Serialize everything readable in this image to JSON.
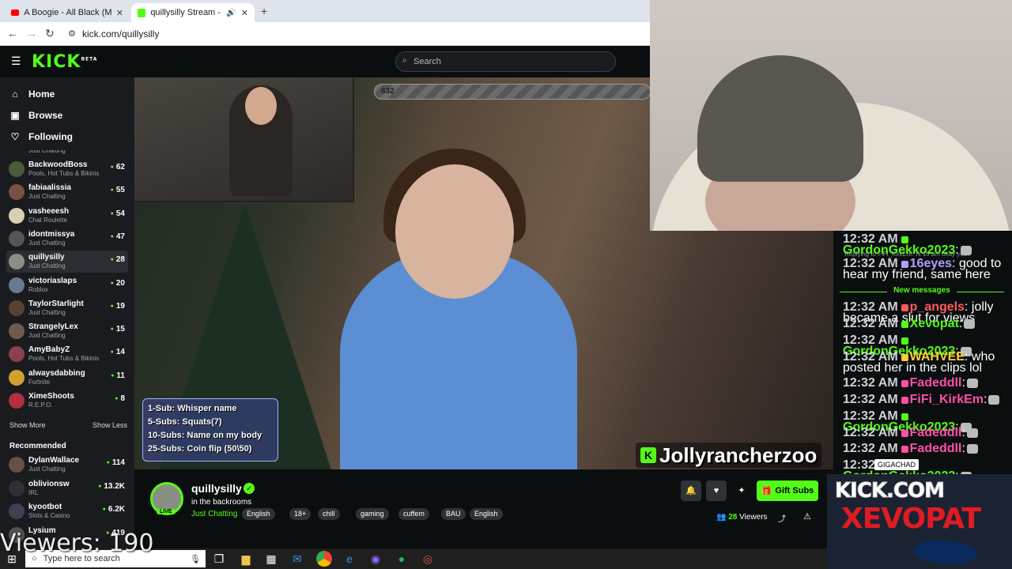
{
  "browser": {
    "tabs": [
      {
        "title": "A Boogie - All Black (Music Vid",
        "icon": "youtube-icon",
        "color": "#ff0000"
      },
      {
        "title": "quillysilly Stream - Watch Li",
        "icon": "kick-icon",
        "color": "#53fc18"
      }
    ],
    "url": "kick.com/quillysilly"
  },
  "header": {
    "logo": "KICK",
    "logo_tag": "BETA",
    "search_placeholder": "Search"
  },
  "sidebar": {
    "nav": [
      {
        "label": "Home",
        "icon": "home-icon"
      },
      {
        "label": "Browse",
        "icon": "browse-icon"
      },
      {
        "label": "Following",
        "icon": "heart-icon"
      }
    ],
    "partial_category": "Just Chatting",
    "following": [
      {
        "name": "BackwoodBoss",
        "category": "Pools, Hot Tubs & Bikinis",
        "viewers": "62",
        "color": "#4a5a3a"
      },
      {
        "name": "fabiaalissia",
        "category": "Just Chatting",
        "viewers": "55",
        "color": "#7a5040"
      },
      {
        "name": "vasheeesh",
        "category": "Chat Roulette",
        "viewers": "54",
        "color": "#d8d0b0"
      },
      {
        "name": "idontmissya",
        "category": "Just Chatting",
        "viewers": "47",
        "color": "#555"
      },
      {
        "name": "quillysilly",
        "category": "Just Chatting",
        "viewers": "28",
        "color": "#8a8f86"
      },
      {
        "name": "victoriaslaps",
        "category": "Roblox",
        "viewers": "20",
        "color": "#6a7a90"
      },
      {
        "name": "TaylorStarlight",
        "category": "Just Chatting",
        "viewers": "19",
        "color": "#5a4030"
      },
      {
        "name": "StrangelyLex",
        "category": "Just Chatting",
        "viewers": "15",
        "color": "#705a50"
      },
      {
        "name": "AmyBabyZ",
        "category": "Pools, Hot Tubs & Bikinis",
        "viewers": "14",
        "color": "#8a4050"
      },
      {
        "name": "alwaysdabbing",
        "category": "Fortnite",
        "viewers": "11",
        "color": "#d0a030"
      },
      {
        "name": "XimeShoots",
        "category": "R.E.P.O.",
        "viewers": "8",
        "color": "#b03040"
      }
    ],
    "show_more": "Show More",
    "show_less": "Show Less",
    "recommended_label": "Recommended",
    "recommended": [
      {
        "name": "DylanWallace",
        "category": "Just Chatting",
        "viewers": "114",
        "color": "#6a5040"
      },
      {
        "name": "oblivionsw",
        "category": "IRL",
        "viewers": "13.2K",
        "color": "#303030"
      },
      {
        "name": "kyootbot",
        "category": "Slots & Casino",
        "viewers": "6.2K",
        "color": "#404050"
      },
      {
        "name": "Lysium",
        "category": "",
        "viewers": "419",
        "color": "#505050"
      }
    ]
  },
  "video": {
    "sub_goal": "632",
    "sub_menu": [
      "1-Sub: Whisper name",
      "5-Subs: Squats(7)",
      "10-Subs: Name on my body",
      "25-Subs: Coin flip (50\\50)"
    ],
    "streamer_overlay": "Jollyrancherzoo"
  },
  "chat": {
    "reply_to": "Replying to FiFi_KirkEm: hi 16 am okay you?",
    "new_messages_label": "New messages",
    "messages": [
      {
        "time": "12:32 AM",
        "user": "GordonGekko2023",
        "color": "#53fc18",
        "text": ":",
        "emote": true
      },
      {
        "time": "12:32 AM",
        "user": "16eyes",
        "color": "#b49cff",
        "text": ": good to hear my friend, same here",
        "emote": false
      },
      {
        "time": "12:32 AM",
        "user": "p_angels",
        "color": "#ff5a5a",
        "text": ": jolly became a slut for views",
        "emote": false
      },
      {
        "time": "12:32 AM",
        "user": "Xevopat",
        "color": "#53fc18",
        "text": ":",
        "emote": true
      },
      {
        "time": "12:32 AM",
        "user": "GordonGekko2023",
        "color": "#53fc18",
        "text": ":",
        "emote": true
      },
      {
        "time": "12:32 AM",
        "user": "WAHVEE",
        "color": "#ffcc33",
        "text": ": who posted her in the clips lol",
        "emote": false
      },
      {
        "time": "12:32 AM",
        "user": "Fadeddll",
        "color": "#ff4fa8",
        "text": ":",
        "emote": true
      },
      {
        "time": "12:32 AM",
        "user": "FiFi_KirkEm",
        "color": "#ff4fa8",
        "text": ":",
        "emote": true
      },
      {
        "time": "12:32 AM",
        "user": "GordonGekko2023",
        "color": "#53fc18",
        "text": ":",
        "emote": true
      },
      {
        "time": "12:32 AM",
        "user": "Fadeddll",
        "color": "#ff4fa8",
        "text": ":",
        "emote": true
      },
      {
        "time": "12:32 AM",
        "user": "Fadeddll",
        "color": "#ff4fa8",
        "text": ":",
        "emote": true
      },
      {
        "time": "12:32 AM",
        "user": "GordonGekko2023",
        "color": "#53fc18",
        "text": ":",
        "emote": true
      }
    ],
    "tooltip": "GIGACHAD"
  },
  "channel": {
    "name": "quillysilly",
    "title": "in the backrooms",
    "category": "Just Chatting",
    "live_label": "LIVE",
    "tags": [
      "English",
      "18+",
      "chill",
      "gaming",
      "cuffem",
      "BAU",
      "English"
    ],
    "gift_label": "Gift Subs",
    "viewers_count": "28",
    "viewers_label": "Viewers"
  },
  "overlay": {
    "brand_line1": "KICK.COM",
    "brand_line2": "XEVOPAT",
    "viewers_text": "Viewers: 190"
  },
  "taskbar": {
    "search_placeholder": "Type here to search"
  }
}
